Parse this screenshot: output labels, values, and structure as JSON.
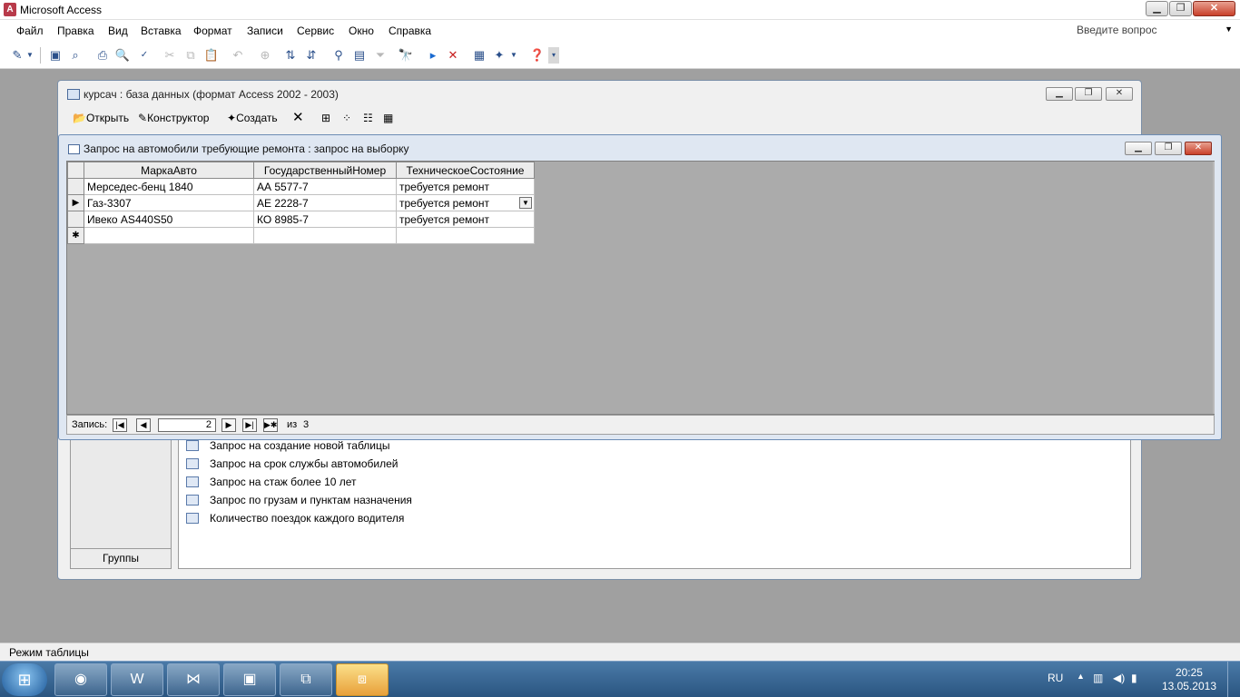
{
  "app": {
    "title": "Microsoft Access",
    "icon_text": "A"
  },
  "window_buttons": {
    "minimize": "▁",
    "restore": "❐",
    "close": "✕"
  },
  "menu": {
    "items": [
      {
        "label": "Файл"
      },
      {
        "label": "Правка"
      },
      {
        "label": "Вид"
      },
      {
        "label": "Вставка"
      },
      {
        "label": "Формат"
      },
      {
        "label": "Записи"
      },
      {
        "label": "Сервис"
      },
      {
        "label": "Окно"
      },
      {
        "label": "Справка"
      }
    ],
    "help_placeholder": "Введите вопрос"
  },
  "db_window": {
    "title": "курсач : база данных (формат Access 2002 - 2003)",
    "tools": {
      "open": "Открыть",
      "design": "Конструктор",
      "create": "Создать"
    },
    "objects": [
      {
        "label": "Запрос на создание новой таблицы",
        "icon": "make-table-query-icon"
      },
      {
        "label": "Запрос на срок службы автомобилей",
        "icon": "select-query-icon"
      },
      {
        "label": "Запрос на стаж более 10 лет",
        "icon": "select-query-icon"
      },
      {
        "label": "Запрос по грузам и пунктам назначения",
        "icon": "select-query-icon"
      },
      {
        "label": "Количество поездок каждого водителя",
        "icon": "select-query-icon"
      }
    ],
    "groups_label": "Группы"
  },
  "query_window": {
    "title": "Запрос на автомобили требующие ремонта : запрос на выборку",
    "columns": [
      "МаркаАвто",
      "ГосударственныйНомер",
      "ТехническоеСостояние"
    ],
    "rows": [
      [
        "Мерседес-бенц 1840",
        "АА 5577-7",
        "требуется ремонт"
      ],
      [
        "Газ-3307",
        "АЕ 2228-7",
        "требуется ремонт"
      ],
      [
        "Ивеко AS440S50",
        "КО 8985-7",
        "требуется ремонт"
      ]
    ],
    "current_row_marker": "▶",
    "new_row_marker": "✱",
    "nav": {
      "label": "Запись:",
      "current": "2",
      "of_label": "из",
      "total": "3"
    }
  },
  "status": {
    "text": "Режим таблицы"
  },
  "taskbar": {
    "tray": {
      "lang": "RU",
      "time": "20:25",
      "date": "13.05.2013"
    }
  }
}
